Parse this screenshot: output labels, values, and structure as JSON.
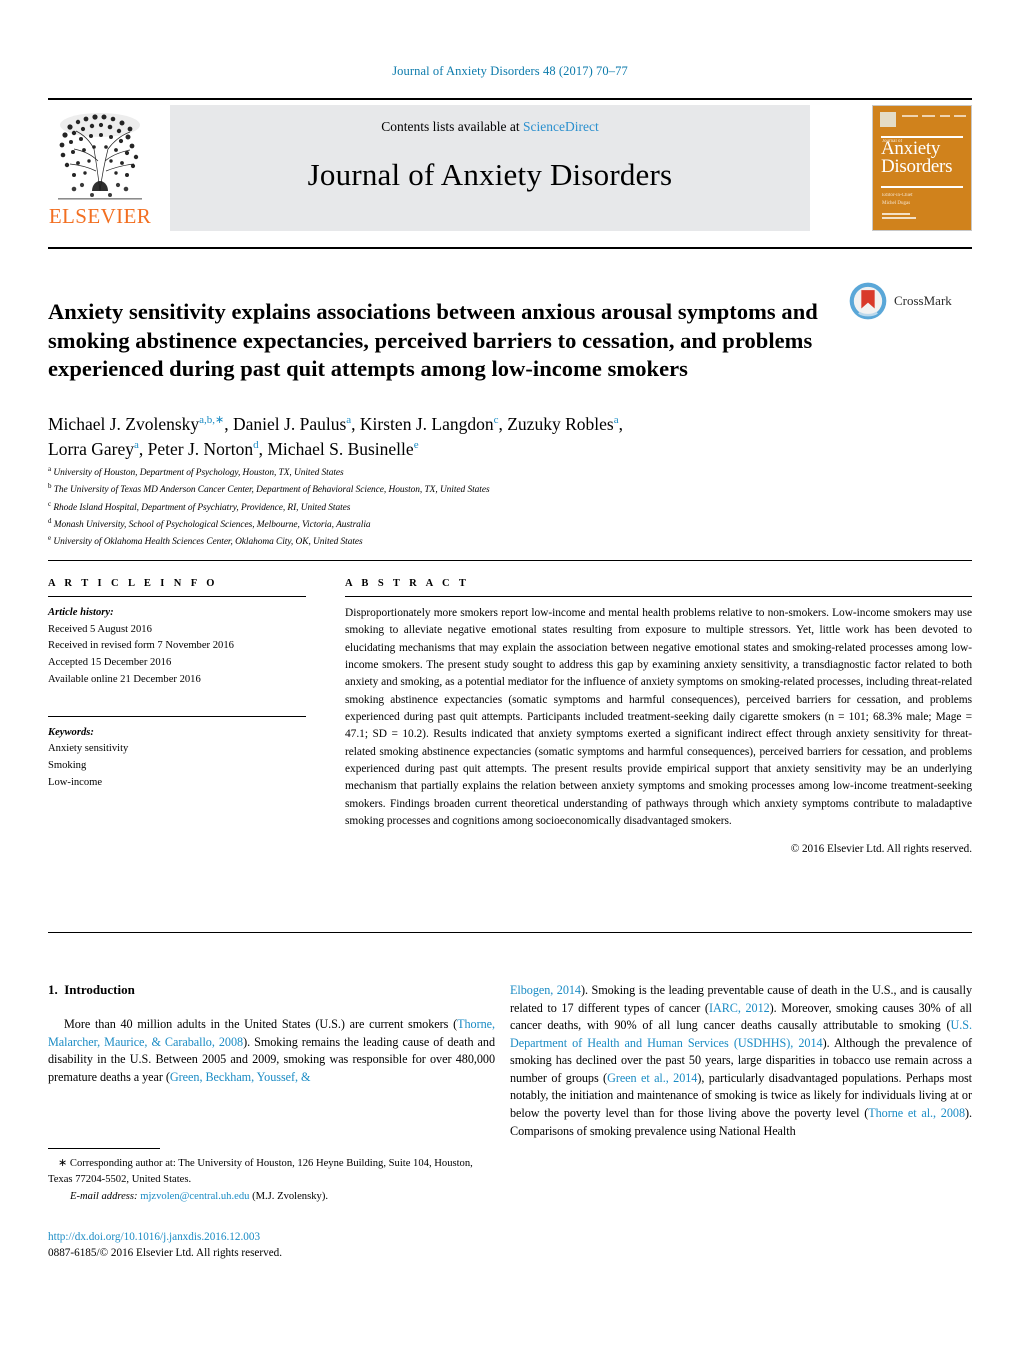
{
  "running_head": "Journal of Anxiety Disorders 48 (2017) 70–77",
  "masthead": {
    "contents_prefix": "Contents lists available at",
    "sciencedirect": "ScienceDirect",
    "journal_name": "Journal of Anxiety Disorders",
    "publisher": "ELSEVIER",
    "cover": {
      "line1": "Anxiety",
      "line2": "Disorders",
      "journal_word": "Journal of"
    }
  },
  "article": {
    "title": "Anxiety sensitivity explains associations between anxious arousal symptoms and smoking abstinence expectancies, perceived barriers to cessation, and problems experienced during past quit attempts among low-income smokers",
    "crossmark_label": "CrossMark",
    "authors_line1": "Michael J. Zvolensky",
    "authors_sup1": "a,b,∗",
    "authors_rest1": ", Daniel J. Paulus",
    "authors_sup2": "a",
    "authors_rest2": ", Kirsten J. Langdon",
    "authors_sup3": "c",
    "authors_rest3": ", Zuzuky Robles",
    "authors_sup4": "a",
    "authors_rest4": ",",
    "authors_line2": "Lorra Garey",
    "authors_sup5": "a",
    "authors_rest5": ", Peter J. Norton",
    "authors_sup6": "d",
    "authors_rest6": ", Michael S. Businelle",
    "authors_sup7": "e",
    "affiliations": [
      {
        "marker": "a",
        "text": "University of Houston, Department of Psychology, Houston, TX, United States"
      },
      {
        "marker": "b",
        "text": "The University of Texas MD Anderson Cancer Center, Department of Behavioral Science, Houston, TX, United States"
      },
      {
        "marker": "c",
        "text": "Rhode Island Hospital, Department of Psychiatry, Providence, RI, United States"
      },
      {
        "marker": "d",
        "text": "Monash University, School of Psychological Sciences, Melbourne, Victoria, Australia"
      },
      {
        "marker": "e",
        "text": "University of Oklahoma Health Sciences Center, Oklahoma City, OK, United States"
      }
    ]
  },
  "article_info": {
    "heading": "A R T I C L E   I N F O",
    "history_label": "Article history:",
    "history": [
      "Received 5 August 2016",
      "Received in revised form 7 November 2016",
      "Accepted 15 December 2016",
      "Available online 21 December 2016"
    ],
    "keywords_label": "Keywords:",
    "keywords": [
      "Anxiety sensitivity",
      "Smoking",
      "Low-income"
    ]
  },
  "abstract": {
    "heading": "A B S T R A C T",
    "text": "Disproportionately more smokers report low-income and mental health problems relative to non-smokers. Low-income smokers may use smoking to alleviate negative emotional states resulting from exposure to multiple stressors. Yet, little work has been devoted to elucidating mechanisms that may explain the association between negative emotional states and smoking-related processes among low-income smokers. The present study sought to address this gap by examining anxiety sensitivity, a transdiagnostic factor related to both anxiety and smoking, as a potential mediator for the influence of anxiety symptoms on smoking-related processes, including threat-related smoking abstinence expectancies (somatic symptoms and harmful consequences), perceived barriers for cessation, and problems experienced during past quit attempts. Participants included treatment-seeking daily cigarette smokers (n = 101; 68.3% male; Mage = 47.1; SD = 10.2). Results indicated that anxiety symptoms exerted a significant indirect effect through anxiety sensitivity for threat-related smoking abstinence expectancies (somatic symptoms and harmful consequences), perceived barriers for cessation, and problems experienced during past quit attempts. The present results provide empirical support that anxiety sensitivity may be an underlying mechanism that partially explains the relation between anxiety symptoms and smoking processes among low-income treatment-seeking smokers. Findings broaden current theoretical understanding of pathways through which anxiety symptoms contribute to maladaptive smoking processes and cognitions among socioeconomically disadvantaged smokers.",
    "copyright": "© 2016 Elsevier Ltd. All rights reserved."
  },
  "body": {
    "section_number": "1.",
    "section_title": "Introduction",
    "left_paragraph_parts": [
      {
        "kind": "text",
        "value": "More than 40 million adults in the United States (U.S.) are current smokers ("
      },
      {
        "kind": "ref",
        "value": "Thorne, Malarcher, Maurice, & Caraballo, 2008"
      },
      {
        "kind": "text",
        "value": "). Smoking remains the leading cause of death and disability in the U.S. Between 2005 and 2009, smoking was responsible for over 480,000 premature deaths a year ("
      },
      {
        "kind": "ref",
        "value": "Green, Beckham, Youssef, &"
      }
    ],
    "right_paragraph_parts": [
      {
        "kind": "ref",
        "value": "Elbogen, 2014"
      },
      {
        "kind": "text",
        "value": "). Smoking is the leading preventable cause of death in the U.S., and is causally related to 17 different types of cancer ("
      },
      {
        "kind": "ref",
        "value": "IARC, 2012"
      },
      {
        "kind": "text",
        "value": "). Moreover, smoking causes 30% of all cancer deaths, with 90% of all lung cancer deaths causally attributable to smoking ("
      },
      {
        "kind": "ref",
        "value": "U.S. Department of Health and Human Services (USDHHS), 2014"
      },
      {
        "kind": "text",
        "value": "). Although the prevalence of smoking has declined over the past 50 years, large disparities in tobacco use remain across a number of groups ("
      },
      {
        "kind": "ref",
        "value": "Green et al., 2014"
      },
      {
        "kind": "text",
        "value": "), particularly disadvantaged populations. Perhaps most notably, the initiation and maintenance of smoking is twice as likely for individuals living at or below the poverty level than for those living above the poverty level ("
      },
      {
        "kind": "ref",
        "value": "Thorne et al., 2008"
      },
      {
        "kind": "text",
        "value": "). Comparisons of smoking prevalence using National Health"
      }
    ]
  },
  "footnote": {
    "star": "∗",
    "corresponding": "Corresponding author at: The University of Houston, 126 Heyne Building, Suite 104, Houston, Texas 77204-5502, United States.",
    "email_label": "E-mail address:",
    "email": "mjzvolen@central.uh.edu",
    "email_suffix": "(M.J. Zvolensky)."
  },
  "doi": {
    "url": "http://dx.doi.org/10.1016/j.janxdis.2016.12.003",
    "issn_line": "0887-6185/© 2016 Elsevier Ltd. All rights reserved."
  },
  "colors": {
    "link": "#1a8bc4",
    "running_head": "#0b7aab",
    "elsevier_orange": "#f26f21",
    "cover_orange": "#d0821c",
    "band_gray": "#e7e8ea"
  }
}
